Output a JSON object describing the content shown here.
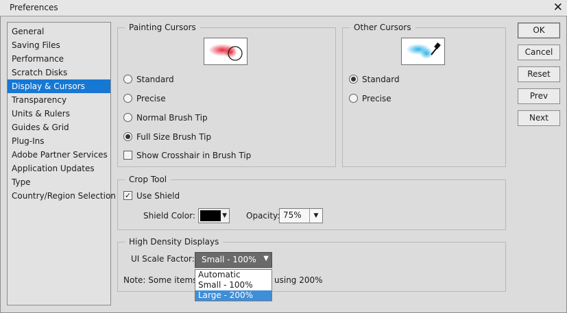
{
  "window": {
    "title": "Preferences"
  },
  "sidebar": {
    "items": [
      {
        "label": "General",
        "selected": false
      },
      {
        "label": "Saving Files",
        "selected": false
      },
      {
        "label": "Performance",
        "selected": false
      },
      {
        "label": "Scratch Disks",
        "selected": false
      },
      {
        "label": "Display & Cursors",
        "selected": true
      },
      {
        "label": "Transparency",
        "selected": false
      },
      {
        "label": "Units & Rulers",
        "selected": false
      },
      {
        "label": "Guides & Grid",
        "selected": false
      },
      {
        "label": "Plug-Ins",
        "selected": false
      },
      {
        "label": "Adobe Partner Services",
        "selected": false
      },
      {
        "label": "Application Updates",
        "selected": false
      },
      {
        "label": "Type",
        "selected": false
      },
      {
        "label": "Country/Region Selection",
        "selected": false
      }
    ]
  },
  "painting_cursors": {
    "title": "Painting Cursors",
    "options": [
      {
        "label": "Standard",
        "checked": false
      },
      {
        "label": "Precise",
        "checked": false
      },
      {
        "label": "Normal Brush Tip",
        "checked": false
      },
      {
        "label": "Full Size Brush Tip",
        "checked": true
      }
    ],
    "crosshair": {
      "label": "Show Crosshair in Brush Tip",
      "checked": false
    }
  },
  "other_cursors": {
    "title": "Other Cursors",
    "options": [
      {
        "label": "Standard",
        "checked": true
      },
      {
        "label": "Precise",
        "checked": false
      }
    ]
  },
  "crop_tool": {
    "title": "Crop Tool",
    "use_shield": {
      "label": "Use Shield",
      "checked": true
    },
    "shield_color_label": "Shield Color:",
    "shield_color": "#000000",
    "opacity_label": "Opacity:",
    "opacity_value": "75%"
  },
  "high_density": {
    "title": "High Density Displays",
    "scale_label": "UI Scale Factor:",
    "scale_value": "Small - 100%",
    "scale_options": [
      {
        "label": "Automatic",
        "highlighted": false
      },
      {
        "label": "Small - 100%",
        "highlighted": false
      },
      {
        "label": "Large - 200%",
        "highlighted": true
      }
    ],
    "note_left": "Note: Some items",
    "note_right": "using 200%"
  },
  "buttons": {
    "ok": "OK",
    "cancel": "Cancel",
    "reset": "Reset",
    "prev": "Prev",
    "next": "Next"
  },
  "colors": {
    "selection": "#1778d4",
    "painting_stroke": "#e8283c",
    "other_stroke": "#2bb4e6"
  }
}
